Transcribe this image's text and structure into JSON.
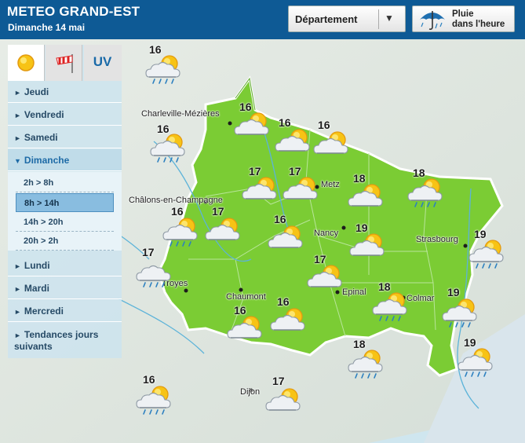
{
  "header": {
    "title": "METEO GRAND-EST",
    "subtitle": "Dimanche 14 mai",
    "department_label": "Département",
    "rain_label_line1": "Pluie",
    "rain_label_line2": "dans l'heure"
  },
  "tabs": [
    {
      "name": "tab-weather",
      "icon": "sun-icon"
    },
    {
      "name": "tab-wind",
      "icon": "windsock-icon"
    },
    {
      "name": "tab-uv",
      "label": "UV"
    }
  ],
  "days": [
    "Jeudi",
    "Vendredi",
    "Samedi",
    "Dimanche",
    "Lundi",
    "Mardi",
    "Mercredi"
  ],
  "active_day": "Dimanche",
  "slots": [
    "2h > 8h",
    "8h > 14h",
    "14h > 20h",
    "20h > 2h"
  ],
  "active_slot": "8h > 14h",
  "tendances": [
    "Tendances jours",
    "suivants"
  ],
  "cities": [
    "Charleville-Mézières",
    "Châlons-en-Champagne",
    "Metz",
    "Nancy",
    "Strasbourg",
    "Troyes",
    "Chaumont",
    "Epinal",
    "Colmar",
    "Dijon"
  ],
  "temperatures": [
    "16",
    "16",
    "16",
    "16",
    "16",
    "17",
    "17",
    "18",
    "18",
    "16",
    "17",
    "16",
    "19",
    "19",
    "17",
    "17",
    "16",
    "18",
    "19",
    "16",
    "18",
    "19",
    "16",
    "17"
  ],
  "colors": {
    "header": "#0e5a95",
    "region": "#7bcc34",
    "sea": "#cfe6ef",
    "accent": "#1d6aa6"
  }
}
